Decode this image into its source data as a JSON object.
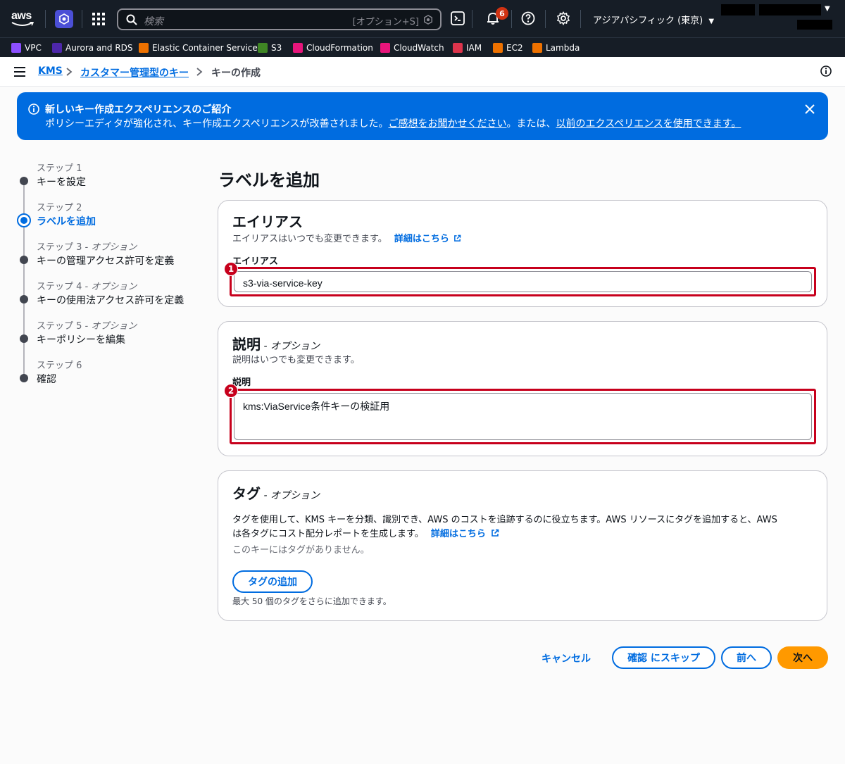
{
  "topnav": {
    "search_placeholder": "検索",
    "search_shortcut": "[オプション+S]",
    "notification_count": "6",
    "region": "アジアパシフィック (東京)"
  },
  "favorites": [
    {
      "label": "VPC",
      "color": "#8c4fff"
    },
    {
      "label": "Aurora and RDS",
      "color": "#4d27aa"
    },
    {
      "label": "Elastic Container Service",
      "color": "#ed7100"
    },
    {
      "label": "S3",
      "color": "#3f8624"
    },
    {
      "label": "CloudFormation",
      "color": "#e7157b"
    },
    {
      "label": "CloudWatch",
      "color": "#e7157b"
    },
    {
      "label": "IAM",
      "color": "#dd344c"
    },
    {
      "label": "EC2",
      "color": "#ed7100"
    },
    {
      "label": "Lambda",
      "color": "#ed7100"
    }
  ],
  "breadcrumb": {
    "items": [
      "KMS",
      "カスタマー管理型のキー",
      "キーの作成"
    ]
  },
  "flash": {
    "title": "新しいキー作成エクスペリエンスのご紹介",
    "body_prefix": "ポリシーエディタが強化され、キー作成エクスペリエンスが改善されました。",
    "feedback_link": "ご感想をお聞かせください",
    "body_mid": "。または、",
    "previous_link": "以前のエクスペリエンスを使用できます。"
  },
  "steps": [
    {
      "label": "ステップ 1",
      "option": "",
      "name": "キーを設定"
    },
    {
      "label": "ステップ 2",
      "option": "",
      "name": "ラベルを追加"
    },
    {
      "label": "ステップ 3",
      "option": " - オプション",
      "name": "キーの管理アクセス許可を定義"
    },
    {
      "label": "ステップ 4",
      "option": " - オプション",
      "name": "キーの使用法アクセス許可を定義"
    },
    {
      "label": "ステップ 5",
      "option": " - オプション",
      "name": "キーポリシーを編集"
    },
    {
      "label": "ステップ 6",
      "option": "",
      "name": "確認"
    }
  ],
  "page_title": "ラベルを追加",
  "alias": {
    "title": "エイリアス",
    "description": "エイリアスはいつでも変更できます。",
    "learn_more": "詳細はこちら",
    "field_label": "エイリアス",
    "value": "s3-via-service-key",
    "marker": "1"
  },
  "description_card": {
    "title": "説明",
    "optional": " - オプション",
    "description": "説明はいつでも変更できます。",
    "field_label": "説明",
    "value": "kms:ViaService条件キーの検証用",
    "marker": "2"
  },
  "tags": {
    "title": "タグ",
    "optional": " - オプション",
    "description_line1": "タグを使用して、KMS キーを分類、識別でき、AWS のコストを追跡するのに役立ちます。AWS リソースにタグを追加すると、AWS",
    "description_line2": "は各タグにコスト配分レポートを生成します。",
    "learn_more": "詳細はこちら",
    "empty": "このキーにはタグがありません。",
    "add_button": "タグの追加",
    "limit_note": "最大 50 個のタグをさらに追加できます。"
  },
  "footer": {
    "cancel": "キャンセル",
    "skip": "確認 にスキップ",
    "previous": "前へ",
    "next": "次へ"
  }
}
